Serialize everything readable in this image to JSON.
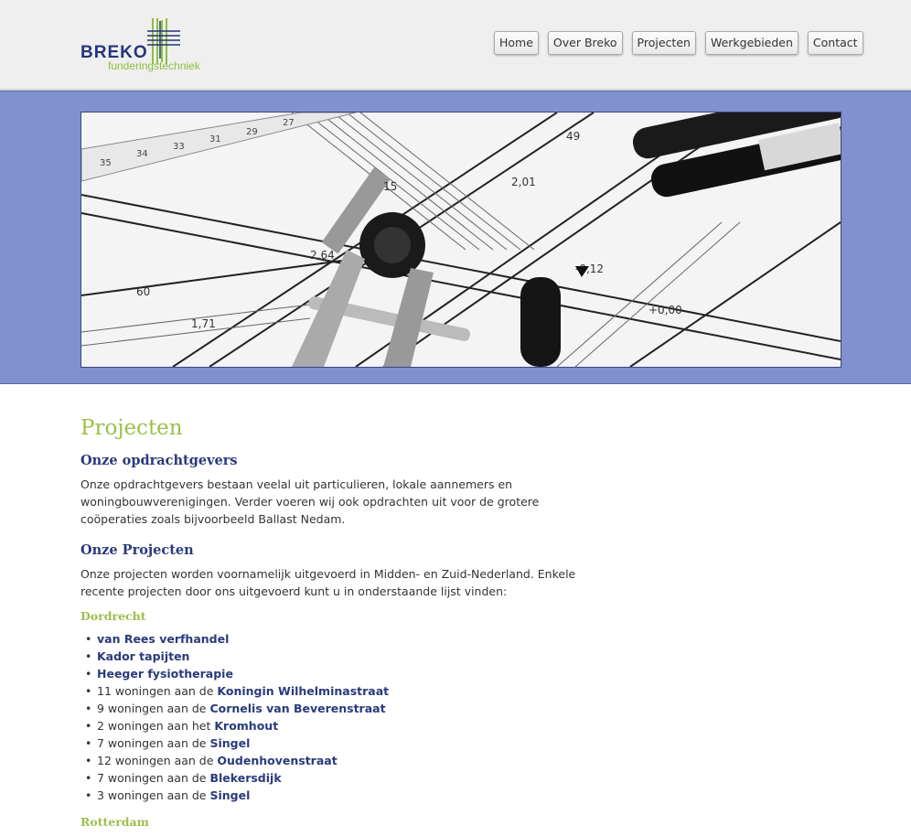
{
  "logo": {
    "name": "BREKO",
    "tagline": "funderingstechniek"
  },
  "colors": {
    "brand_blue": "#24357a",
    "brand_green": "#8cbf3f",
    "banner": "#8190cf"
  },
  "nav": {
    "items": [
      {
        "label": "Home"
      },
      {
        "label": "Over Breko"
      },
      {
        "label": "Projecten"
      },
      {
        "label": "Werkgebieden"
      },
      {
        "label": "Contact"
      }
    ]
  },
  "hero": {
    "image": "architectural-blueprint-photo"
  },
  "page": {
    "title": "Projecten",
    "clients": {
      "heading": "Onze opdrachtgevers",
      "text": "Onze opdrachtgevers bestaan veelal uit particulieren, lokale aannemers en woningbouwverenigingen. Verder voeren wij ook opdrachten uit voor de grotere coöperaties zoals bijvoorbeeld Ballast Nedam."
    },
    "projects": {
      "heading": "Onze Projecten",
      "text": "Onze projecten worden voornamelijk uitgevoerd in Midden- en Zuid-Nederland. Enkele recente projecten door ons uitgevoerd kunt u in onderstaande lijst vinden:"
    },
    "cities": [
      {
        "name": "Dordrecht",
        "items": [
          {
            "prefix": "",
            "link": "van Rees verfhandel"
          },
          {
            "prefix": "",
            "link": "Kador tapijten"
          },
          {
            "prefix": "",
            "link": "Heeger fysiotherapie"
          },
          {
            "prefix": "11 woningen aan de ",
            "link": "Koningin Wilhelminastraat"
          },
          {
            "prefix": "9 woningen aan de ",
            "link": "Cornelis van Beverenstraat"
          },
          {
            "prefix": "2 woningen aan het ",
            "link": "Kromhout"
          },
          {
            "prefix": "7 woningen aan de ",
            "link": "Singel"
          },
          {
            "prefix": "12 woningen aan de ",
            "link": "Oudenhovenstraat"
          },
          {
            "prefix": "7 woningen aan de ",
            "link": "Blekersdijk"
          },
          {
            "prefix": "3 woningen aan de ",
            "link": "Singel"
          }
        ]
      },
      {
        "name": "Rotterdam",
        "items": []
      }
    ]
  }
}
